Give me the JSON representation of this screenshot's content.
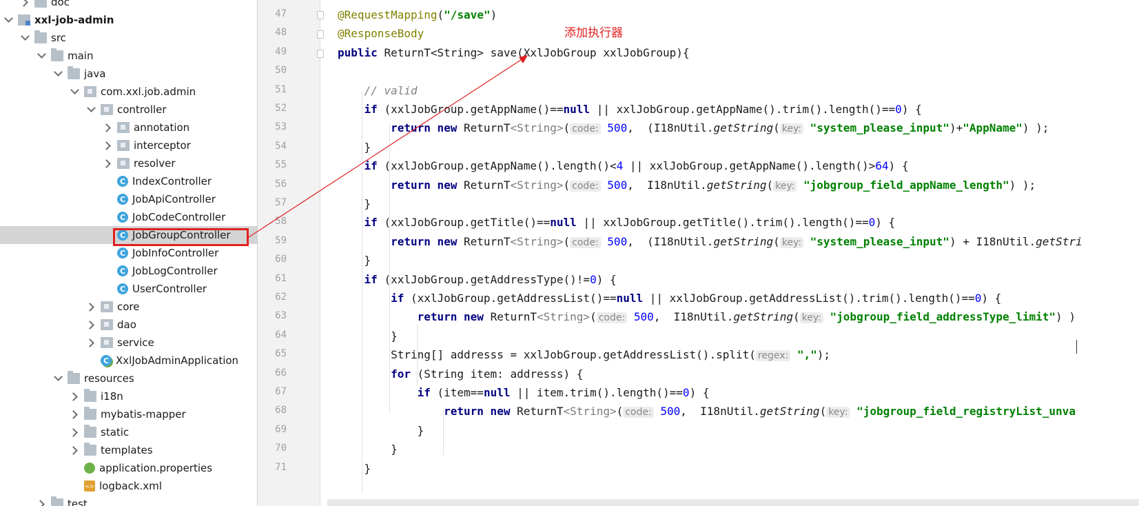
{
  "tree": {
    "items": [
      {
        "label": "doc",
        "indent": 1,
        "chev": "right",
        "icon": "folder"
      },
      {
        "label": "xxl-job-admin",
        "indent": 0,
        "chev": "down",
        "icon": "module",
        "bold": true
      },
      {
        "label": "src",
        "indent": 1,
        "chev": "down",
        "icon": "folder"
      },
      {
        "label": "main",
        "indent": 2,
        "chev": "down",
        "icon": "folder"
      },
      {
        "label": "java",
        "indent": 3,
        "chev": "down",
        "icon": "folder"
      },
      {
        "label": "com.xxl.job.admin",
        "indent": 4,
        "chev": "down",
        "icon": "pkg"
      },
      {
        "label": "controller",
        "indent": 5,
        "chev": "down",
        "icon": "pkg"
      },
      {
        "label": "annotation",
        "indent": 6,
        "chev": "right",
        "icon": "pkg"
      },
      {
        "label": "interceptor",
        "indent": 6,
        "chev": "right",
        "icon": "pkg"
      },
      {
        "label": "resolver",
        "indent": 6,
        "chev": "right",
        "icon": "pkg"
      },
      {
        "label": "IndexController",
        "indent": 6,
        "chev": "none",
        "icon": "cls"
      },
      {
        "label": "JobApiController",
        "indent": 6,
        "chev": "none",
        "icon": "cls"
      },
      {
        "label": "JobCodeController",
        "indent": 6,
        "chev": "none",
        "icon": "cls"
      },
      {
        "label": "JobGroupController",
        "indent": 6,
        "chev": "none",
        "icon": "cls",
        "selected": true
      },
      {
        "label": "JobInfoController",
        "indent": 6,
        "chev": "none",
        "icon": "cls"
      },
      {
        "label": "JobLogController",
        "indent": 6,
        "chev": "none",
        "icon": "cls"
      },
      {
        "label": "UserController",
        "indent": 6,
        "chev": "none",
        "icon": "cls"
      },
      {
        "label": "core",
        "indent": 5,
        "chev": "right",
        "icon": "pkg"
      },
      {
        "label": "dao",
        "indent": 5,
        "chev": "right",
        "icon": "pkg"
      },
      {
        "label": "service",
        "indent": 5,
        "chev": "right",
        "icon": "pkg"
      },
      {
        "label": "XxlJobAdminApplication",
        "indent": 5,
        "chev": "none",
        "icon": "app"
      },
      {
        "label": "resources",
        "indent": 3,
        "chev": "down",
        "icon": "folder"
      },
      {
        "label": "i18n",
        "indent": 4,
        "chev": "right",
        "icon": "folder"
      },
      {
        "label": "mybatis-mapper",
        "indent": 4,
        "chev": "right",
        "icon": "folder"
      },
      {
        "label": "static",
        "indent": 4,
        "chev": "right",
        "icon": "folder"
      },
      {
        "label": "templates",
        "indent": 4,
        "chev": "right",
        "icon": "folder"
      },
      {
        "label": "application.properties",
        "indent": 4,
        "chev": "none",
        "icon": "props"
      },
      {
        "label": "logback.xml",
        "indent": 4,
        "chev": "none",
        "icon": "xml"
      },
      {
        "label": "test",
        "indent": 2,
        "chev": "right",
        "icon": "folder"
      }
    ]
  },
  "annotation": {
    "text": "添加执行器"
  },
  "editor": {
    "line_numbers": [
      "47",
      "48",
      "49",
      "50",
      "51",
      "52",
      "53",
      "54",
      "55",
      "56",
      "57",
      "58",
      "59",
      "60",
      "61",
      "62",
      "63",
      "64",
      "65",
      "66",
      "67",
      "68",
      "69",
      "70",
      "71"
    ],
    "lines": [
      [
        {
          "c": "an",
          "t": "@RequestMapping"
        },
        {
          "t": "("
        },
        {
          "c": "st",
          "t": "\"/save\""
        },
        {
          "t": ")"
        }
      ],
      [
        {
          "c": "an",
          "t": "@ResponseBody"
        }
      ],
      [
        {
          "c": "kw",
          "t": "public "
        },
        {
          "t": "ReturnT<String> save(XxlJobGroup xxlJobGroup){"
        }
      ],
      [],
      [
        {
          "c": "cm",
          "t": "    // valid"
        }
      ],
      [
        {
          "c": "kw",
          "t": "    if "
        },
        {
          "t": "(xxlJobGroup.getAppName()=="
        },
        {
          "c": "kw",
          "t": "null"
        },
        {
          "t": " || xxlJobGroup.getAppName().trim().length()=="
        },
        {
          "c": "nm",
          "t": "0"
        },
        {
          "t": ") {"
        }
      ],
      [
        {
          "c": "kw",
          "t": "        return new "
        },
        {
          "t": "ReturnT"
        },
        {
          "c": "gn",
          "t": "<String>"
        },
        {
          "t": "("
        },
        {
          "c": "hint",
          "t": "code:"
        },
        {
          "t": " "
        },
        {
          "c": "nm",
          "t": "500"
        },
        {
          "t": ",  (I18nUtil."
        },
        {
          "c": "it",
          "t": "getString"
        },
        {
          "t": "("
        },
        {
          "c": "hint",
          "t": "key:"
        },
        {
          "t": " "
        },
        {
          "c": "st",
          "t": "\"system_please_input\""
        },
        {
          "t": ")+"
        },
        {
          "c": "st",
          "t": "\"AppName\""
        },
        {
          "t": ") );"
        }
      ],
      [
        {
          "t": "    }"
        }
      ],
      [
        {
          "c": "kw",
          "t": "    if "
        },
        {
          "t": "(xxlJobGroup.getAppName().length()<"
        },
        {
          "c": "nm",
          "t": "4"
        },
        {
          "t": " || xxlJobGroup.getAppName().length()>"
        },
        {
          "c": "nm",
          "t": "64"
        },
        {
          "t": ") {"
        }
      ],
      [
        {
          "c": "kw",
          "t": "        return new "
        },
        {
          "t": "ReturnT"
        },
        {
          "c": "gn",
          "t": "<String>"
        },
        {
          "t": "("
        },
        {
          "c": "hint",
          "t": "code:"
        },
        {
          "t": " "
        },
        {
          "c": "nm",
          "t": "500"
        },
        {
          "t": ",  I18nUtil."
        },
        {
          "c": "it",
          "t": "getString"
        },
        {
          "t": "("
        },
        {
          "c": "hint",
          "t": "key:"
        },
        {
          "t": " "
        },
        {
          "c": "st",
          "t": "\"jobgroup_field_appName_length\""
        },
        {
          "t": ") );"
        }
      ],
      [
        {
          "t": "    }"
        }
      ],
      [
        {
          "c": "kw",
          "t": "    if "
        },
        {
          "t": "(xxlJobGroup.getTitle()=="
        },
        {
          "c": "kw",
          "t": "null"
        },
        {
          "t": " || xxlJobGroup.getTitle().trim().length()=="
        },
        {
          "c": "nm",
          "t": "0"
        },
        {
          "t": ") {"
        }
      ],
      [
        {
          "c": "kw",
          "t": "        return new "
        },
        {
          "t": "ReturnT"
        },
        {
          "c": "gn",
          "t": "<String>"
        },
        {
          "t": "("
        },
        {
          "c": "hint",
          "t": "code:"
        },
        {
          "t": " "
        },
        {
          "c": "nm",
          "t": "500"
        },
        {
          "t": ",  (I18nUtil."
        },
        {
          "c": "it",
          "t": "getString"
        },
        {
          "t": "("
        },
        {
          "c": "hint",
          "t": "key:"
        },
        {
          "t": " "
        },
        {
          "c": "st",
          "t": "\"system_please_input\""
        },
        {
          "t": ") + I18nUtil."
        },
        {
          "c": "it",
          "t": "getStri"
        }
      ],
      [
        {
          "t": "    }"
        }
      ],
      [
        {
          "c": "kw",
          "t": "    if "
        },
        {
          "t": "(xxlJobGroup.getAddressType()!="
        },
        {
          "c": "nm",
          "t": "0"
        },
        {
          "t": ") {"
        }
      ],
      [
        {
          "c": "kw",
          "t": "        if "
        },
        {
          "t": "(xxlJobGroup.getAddressList()=="
        },
        {
          "c": "kw",
          "t": "null"
        },
        {
          "t": " || xxlJobGroup.getAddressList().trim().length()=="
        },
        {
          "c": "nm",
          "t": "0"
        },
        {
          "t": ") {"
        }
      ],
      [
        {
          "c": "kw",
          "t": "            return new "
        },
        {
          "t": "ReturnT"
        },
        {
          "c": "gn",
          "t": "<String>"
        },
        {
          "t": "("
        },
        {
          "c": "hint",
          "t": "code:"
        },
        {
          "t": " "
        },
        {
          "c": "nm",
          "t": "500"
        },
        {
          "t": ",  I18nUtil."
        },
        {
          "c": "it",
          "t": "getString"
        },
        {
          "t": "("
        },
        {
          "c": "hint",
          "t": "key:"
        },
        {
          "t": " "
        },
        {
          "c": "st",
          "t": "\"jobgroup_field_addressType_limit\""
        },
        {
          "t": ") )"
        }
      ],
      [
        {
          "t": "        }"
        }
      ],
      [
        {
          "t": "        String[] addresss = xxlJobGroup.getAddressList().split("
        },
        {
          "c": "hint",
          "t": "regex:"
        },
        {
          "t": " "
        },
        {
          "c": "st",
          "t": "\",\""
        },
        {
          "t": ");"
        }
      ],
      [
        {
          "c": "kw",
          "t": "        for "
        },
        {
          "t": "(String item: addresss) {"
        }
      ],
      [
        {
          "c": "kw",
          "t": "            if "
        },
        {
          "t": "(item=="
        },
        {
          "c": "kw",
          "t": "null"
        },
        {
          "t": " || item.trim().length()=="
        },
        {
          "c": "nm",
          "t": "0"
        },
        {
          "t": ") {"
        }
      ],
      [
        {
          "c": "kw",
          "t": "                return new "
        },
        {
          "t": "ReturnT"
        },
        {
          "c": "gn",
          "t": "<String>"
        },
        {
          "t": "("
        },
        {
          "c": "hint",
          "t": "code:"
        },
        {
          "t": " "
        },
        {
          "c": "nm",
          "t": "500"
        },
        {
          "t": ",  I18nUtil."
        },
        {
          "c": "it",
          "t": "getString"
        },
        {
          "t": "("
        },
        {
          "c": "hint",
          "t": "key:"
        },
        {
          "t": " "
        },
        {
          "c": "st",
          "t": "\"jobgroup_field_registryList_unva"
        }
      ],
      [
        {
          "t": "            }"
        }
      ],
      [
        {
          "t": "        }"
        }
      ],
      [
        {
          "t": "    }"
        }
      ]
    ]
  },
  "colors": {
    "annotation": "#e02020",
    "selection": "#d4d4d4",
    "keyword": "#000080",
    "string": "#008000",
    "number": "#0000ff",
    "annotation_code": "#808000"
  }
}
